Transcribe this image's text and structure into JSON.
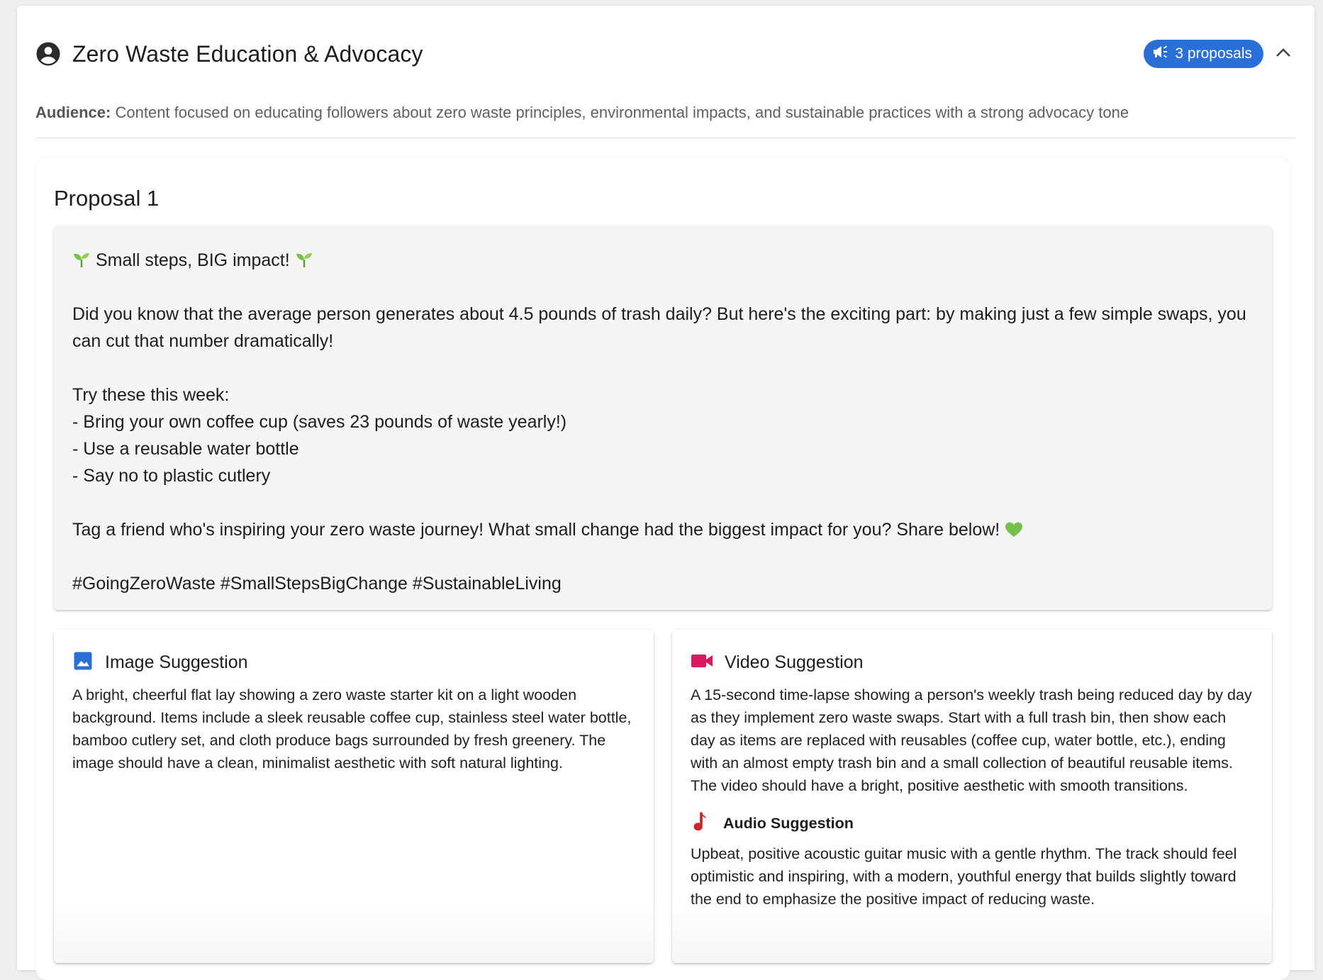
{
  "persona": {
    "name": "Zero Waste Education & Advocacy",
    "icon": "account-circle-icon",
    "proposals_badge": "3 proposals",
    "badge_icon": "campaign-icon",
    "badge_color": "#2a6fd6",
    "collapse_icon": "chevron-up-icon"
  },
  "audience": {
    "label": "Audience:",
    "text": "Content focused on educating followers about zero waste principles, environmental impacts, and sustainable practices with a strong advocacy tone"
  },
  "proposal": {
    "title": "Proposal 1",
    "post": {
      "headline": "Small steps, BIG impact!",
      "headline_icon": "seedling-emoji",
      "intro": "Did you know that the average person generates about 4.5 pounds of trash daily? But here's the exciting part: by making just a few simple swaps, you can cut that number dramatically!",
      "list_intro": "Try these this week:",
      "list_items": [
        "- Bring your own coffee cup (saves 23 pounds of waste yearly!)",
        "- Use a reusable water bottle",
        "- Say no to plastic cutlery"
      ],
      "call_to_action": "Tag a friend who's inspiring your zero waste journey! What small change had the biggest impact for you? Share below!",
      "cta_icon": "green-heart-emoji",
      "hashtags": "#GoingZeroWaste #SmallStepsBigChange #SustainableLiving"
    },
    "image_suggestion": {
      "title": "Image Suggestion",
      "icon": "image-icon",
      "icon_color": "#2a6fd6",
      "text": "A bright, cheerful flat lay showing a zero waste starter kit on a light wooden background. Items include a sleek reusable coffee cup, stainless steel water bottle, bamboo cutlery set, and cloth produce bags surrounded by fresh greenery. The image should have a clean, minimalist aesthetic with soft natural lighting."
    },
    "video_suggestion": {
      "title": "Video Suggestion",
      "icon": "videocam-icon",
      "icon_color": "#d81b60",
      "text": "A 15-second time-lapse showing a person's weekly trash being reduced day by day as they implement zero waste swaps. Start with a full trash bin, then show each day as items are replaced with reusables (coffee cup, water bottle, etc.), ending with an almost empty trash bin and a small collection of beautiful reusable items. The video should have a bright, positive aesthetic with smooth transitions."
    },
    "audio_suggestion": {
      "title": "Audio Suggestion",
      "icon": "music-note-icon",
      "icon_color": "#c62828",
      "text": "Upbeat, positive acoustic guitar music with a gentle rhythm. The track should feel optimistic and inspiring, with a modern, youthful energy that builds slightly toward the end to emphasize the positive impact of reducing waste."
    }
  }
}
